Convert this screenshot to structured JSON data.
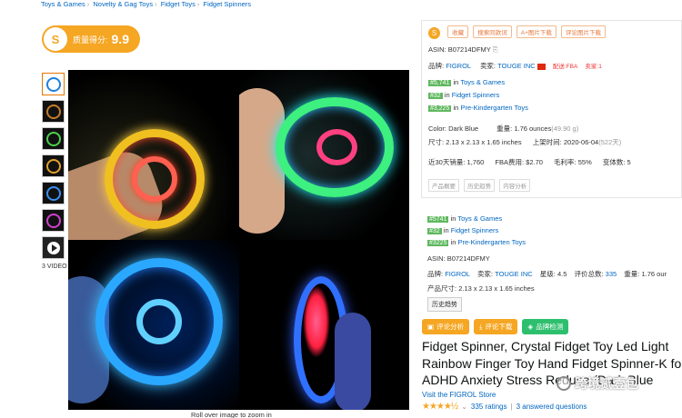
{
  "breadcrumb": [
    "Toys & Games",
    "Novelty & Gag Toys",
    "Fidget Toys",
    "Fidget Spinners"
  ],
  "score": {
    "label": "质量得分:",
    "value": "9.9",
    "icon": "S"
  },
  "thumbnails": [
    "spinner-blue",
    "spinner-dark",
    "spinner-green",
    "spinner-rainbow",
    "spinner-blue-hand",
    "spinner-multi",
    "video"
  ],
  "videos_label": "3 VIDEO",
  "zoom_note": "Roll over image to zoom in",
  "panel1": {
    "tool_icon": "S",
    "buttons": [
      "收藏",
      "搜索同款词",
      "A+图片下载",
      "评论图片下载"
    ],
    "asin_label": "ASIN:",
    "asin": "B07214DFMY",
    "brand_label": "品牌:",
    "brand": "FIGROL",
    "seller_label": "卖家:",
    "seller": "TOUGE INC",
    "ship_tag": "配送:FBA",
    "sellers_tag": "卖家:1",
    "ranks": [
      {
        "rank": "#5,741",
        "cat": "Toys & Games"
      },
      {
        "rank": "#32",
        "cat": "Fidget Spinners"
      },
      {
        "rank": "#3,225",
        "cat": "Pre-Kindergarten Toys"
      }
    ],
    "color_label": "Color:",
    "color": "Dark Blue",
    "weight_label": "重量:",
    "weight": "1.76 ounces",
    "weight_g": "(49.90 g)",
    "size_label": "尺寸:",
    "size": "2.13 x 2.13 x 1.65 inches",
    "listed_label": "上架时间:",
    "listed": "2020-06-04",
    "listed_days": "(522天)",
    "sales_label": "近30天销量:",
    "sales": "1,760",
    "fba_label": "FBA费用:",
    "fba": "$2.70",
    "margin_label": "毛利率:",
    "margin": "55%",
    "variants_label": "变体数:",
    "variants": "5",
    "bottom_tags": [
      "产品概要",
      "历史趋势",
      "内容分析"
    ]
  },
  "panel2": {
    "ranks": [
      {
        "rank": "#5741",
        "prefix": "in",
        "cat": "Toys & Games"
      },
      {
        "rank": "#32",
        "prefix": "in",
        "cat": "Fidget Spinners"
      },
      {
        "rank": "#3225",
        "prefix": "in",
        "cat": "Pre-Kindergarten Toys"
      }
    ],
    "asin_label": "ASIN:",
    "asin": "B07214DFMY",
    "brand_label": "品牌:",
    "brand": "FIGROL",
    "seller_label": "卖家:",
    "seller": "TOUGE INC",
    "stars_label": "星级:",
    "stars": "4.5",
    "reviews_label": "评价总数:",
    "reviews": "335",
    "weight_label": "重量:",
    "weight": "1.76 our",
    "size_label": "产品尺寸:",
    "size": "2.13 x 2.13 x 1.65 inches",
    "history_button": "历史趋势"
  },
  "actions": [
    "评论分析",
    "评论下载",
    "品牌检测"
  ],
  "title": "Fidget Spinner, Crystal Fidget Toy Led Light Rainbow Finger Toy Hand Fidget Spinner-K for ADHD Anxiety Stress Reduce (Dark Blue",
  "store": "Visit the FIGROL Store",
  "ratings": {
    "stars": "★★★★½",
    "count": "335 ratings",
    "sep": "|",
    "questions": "3 answered questions"
  },
  "watermark": "跨境贰壹包"
}
